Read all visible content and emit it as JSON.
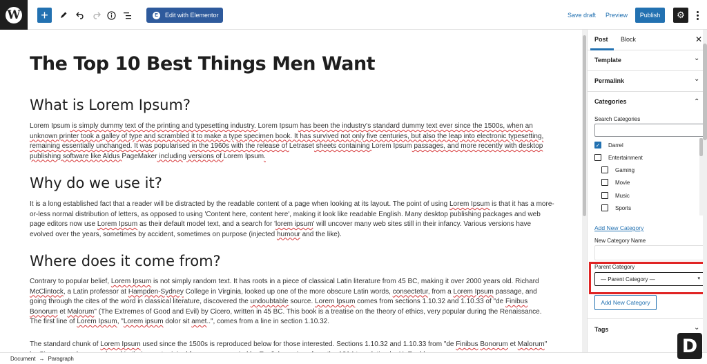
{
  "toolbar": {
    "add_icon": "plus-icon",
    "edit_label": "Edit with Elementor",
    "save_draft": "Save draft",
    "preview": "Preview",
    "publish": "Publish"
  },
  "post": {
    "title": "The Top 10 Best Things Men Want",
    "sections": [
      {
        "heading": "What is Lorem Ipsum?"
      },
      {
        "heading": "Why do we use it?"
      },
      {
        "heading": "Where does it come from?"
      }
    ],
    "p1": [
      "Lorem Ipsum",
      " is simply dummy text of the printing and typesetting industry. ",
      "Lorem Ipsum",
      " has been the industry's standard dummy text ever since the 1500s, when an unknown printer took a galley of type and scrambled it to make a type specimen book. It has survived not only five centuries, but also the leap into electronic typesetting, remaining essentially unchanged. It was ",
      "popularised",
      " in the 1960s with the release of ",
      "Letraset",
      " sheets containing ",
      "Lorem Ipsum",
      " passages, and more recently with desktop publishing software like Aldus ",
      "PageMaker",
      " including versions of ",
      "Lorem Ipsum",
      "."
    ],
    "p2": [
      "It is a long established fact that a reader will be distracted by the readable content of a page when looking at its layout. The point of using ",
      "Lorem Ipsum",
      " is that it has a more-or-less normal distribution of letters, as opposed to using 'Content here, content here', making it look like readable English. Many desktop publishing packages and web page editors now use ",
      "Lorem Ipsum",
      " as their default model text, and a search for '",
      "lorem ipsum",
      "' will uncover many web sites still in their infancy. Various versions have evolved over the years, sometimes by accident, sometimes on purpose (injected ",
      "humour",
      " and the like)."
    ],
    "p3": [
      "Contrary to popular belief, ",
      "Lorem Ipsum",
      " is not simply random text. It has roots in a piece of classical Latin literature from 45 BC, making it over 2000 years old. Richard ",
      "McClintock",
      ", a Latin professor at ",
      "Hampden-Sydney",
      " College in Virginia, looked up one of the more obscure Latin words, ",
      "consectetur",
      ", from a ",
      "Lorem Ipsum",
      " passage, and going through the cites of the word in classical literature, discovered the ",
      "undoubtable",
      " source. ",
      "Lorem Ipsum",
      " comes from sections 1.10.32 and 1.10.33 of \"de ",
      "Finibus",
      " ",
      "Bonorum",
      " et ",
      "Malorum",
      "\" (The Extremes of Good and Evil) by Cicero, written in 45 BC. This book is a treatise on the theory of ethics, very popular during the Renaissance. The first line of ",
      "Lorem Ipsum",
      ", \"",
      "Lorem ipsum",
      " dolor sit ",
      "amet",
      "..\", comes from a line in section 1.10.32."
    ],
    "p4": [
      "The standard chunk of ",
      "Lorem Ipsum",
      " used since the 1500s is reproduced below for those interested. Sections 1.10.32 and 1.10.33 from \"de ",
      "Finibus",
      " ",
      "Bonorum",
      " et ",
      "Malorum",
      "\" by Cicero are also reproduced in their exact original form, accompanied by English versions from the 1914 translation by H. Rackham."
    ]
  },
  "sidebar": {
    "tabs": [
      "Post",
      "Block"
    ],
    "panels": {
      "template": "Template",
      "permalink": "Permalink",
      "categories": "Categories",
      "tags": "Tags"
    },
    "search_label": "Search Categories",
    "categories": [
      {
        "name": "Darrel",
        "checked": true,
        "indent": false
      },
      {
        "name": "Entertainment",
        "checked": false,
        "indent": false
      },
      {
        "name": "Gaming",
        "checked": false,
        "indent": true
      },
      {
        "name": "Movie",
        "checked": false,
        "indent": true
      },
      {
        "name": "Music",
        "checked": false,
        "indent": true
      },
      {
        "name": "Sports",
        "checked": false,
        "indent": true
      }
    ],
    "add_new_link": "Add New Category",
    "new_name_label": "New Category Name",
    "parent_label": "Parent Category",
    "parent_value": "— Parent Category —",
    "add_button": "Add New Category"
  },
  "footer": {
    "crumb1": "Document",
    "arrow": "→",
    "crumb2": "Paragraph"
  },
  "watermark": "D"
}
